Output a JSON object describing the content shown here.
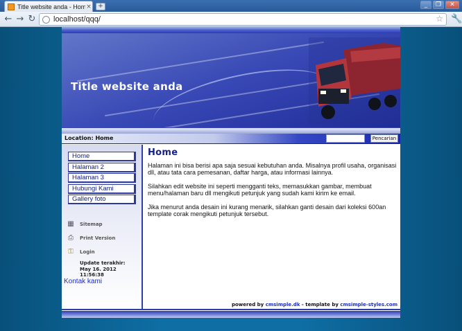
{
  "browser": {
    "tab_title": "Title website anda - Home",
    "tab_close": "×",
    "newtab": "+",
    "url": "localhost/qqq/",
    "back": "←",
    "forward": "→",
    "reload": "↻",
    "star": "☆",
    "wrench": "🔧",
    "minimize": "_",
    "restore": "❐",
    "close": "✕"
  },
  "site": {
    "title": "Title website anda",
    "location": "Location: Home",
    "search_button": "Pencarian",
    "menu": [
      "Home",
      "Halaman 2",
      "Halaman 3",
      "Hubungi Kami",
      "Gallery foto"
    ],
    "tools": {
      "sitemap": "Sitemap",
      "print": "Print Version",
      "login": "Login"
    },
    "update_label": "Update terakhir:",
    "update_date": "May 16. 2012",
    "update_time": "11:56:38",
    "contact": "Kontak kami",
    "page_heading": "Home",
    "paragraphs": [
      "Halaman ini bisa berisi apa saja sesuai kebutuhan anda. Misalnya profil usaha, organisasi dll, atau tata cara pemesanan, daftar harga, atau informasi lainnya.",
      "Silahkan edit website ini seperti mengganti teks, memasukkan gambar, membuat menu/halaman baru dll mengikuti petunjuk yang sudah kami kirim ke email.",
      "Jika menurut anda desain ini kurang menarik, silahkan ganti desain dari koleksi 600an template corak mengikuti petunjuk tersebut."
    ],
    "footer": {
      "powered_by": "powered by ",
      "cms": "cmsimple.dk",
      "template_by": " - template by ",
      "styles": "cmsimple-styles.com"
    }
  }
}
